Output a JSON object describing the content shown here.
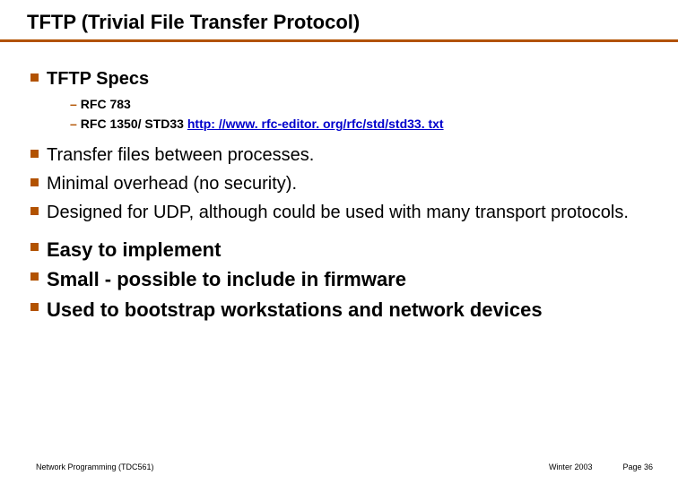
{
  "title": "TFTP (Trivial File Transfer Protocol)",
  "specs": {
    "heading": "TFTP Specs",
    "items": {
      "a": "RFC 783",
      "b_prefix": "RFC 1350/ STD33  ",
      "b_link": "http: //www. rfc-editor. org/rfc/std/std33. txt"
    }
  },
  "body": {
    "b1": "Transfer files between processes.",
    "b2": "Minimal overhead (no security).",
    "b3": "Designed for UDP, although could be used with many transport protocols."
  },
  "body2": {
    "b1": "Easy to implement",
    "b2": "Small - possible to include in firmware",
    "b3": "Used to bootstrap workstations and network devices"
  },
  "footer": {
    "left": "Network Programming (TDC561)",
    "mid": "Winter  2003",
    "right": "Page 36"
  }
}
